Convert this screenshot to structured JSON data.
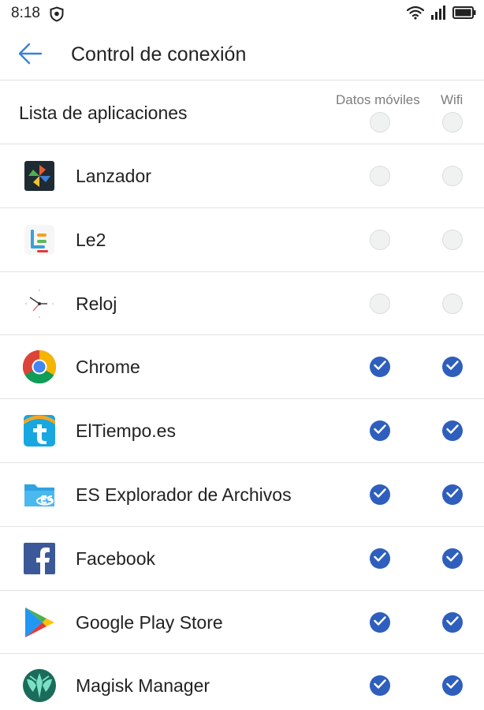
{
  "status_bar": {
    "time": "8:18",
    "left_icons": [
      "shield-icon"
    ],
    "right_icons": [
      "wifi-icon",
      "signal-icon",
      "battery-icon"
    ]
  },
  "app_bar": {
    "back_icon": "arrow-left-icon",
    "title": "Control de conexión"
  },
  "list_header": {
    "title": "Lista de aplicaciones",
    "col_mobile": "Datos móviles",
    "col_wifi": "Wifi",
    "mobile_checked": false,
    "wifi_checked": false
  },
  "apps": [
    {
      "name": "Lanzador",
      "icon": "lanzador-icon",
      "mobile": false,
      "wifi": false
    },
    {
      "name": "Le2",
      "icon": "le2-icon",
      "mobile": false,
      "wifi": false
    },
    {
      "name": "Reloj",
      "icon": "clock-icon",
      "mobile": false,
      "wifi": false
    },
    {
      "name": "Chrome",
      "icon": "chrome-icon",
      "mobile": true,
      "wifi": true
    },
    {
      "name": "ElTiempo.es",
      "icon": "eltiempo-icon",
      "mobile": true,
      "wifi": true
    },
    {
      "name": "ES Explorador de Archivos",
      "icon": "es-explorer-icon",
      "mobile": true,
      "wifi": true
    },
    {
      "name": "Facebook",
      "icon": "facebook-icon",
      "mobile": true,
      "wifi": true
    },
    {
      "name": "Google Play Store",
      "icon": "play-store-icon",
      "mobile": true,
      "wifi": true
    },
    {
      "name": "Magisk Manager",
      "icon": "magisk-icon",
      "mobile": true,
      "wifi": true
    }
  ],
  "colors": {
    "accent": "#2f5fbd",
    "back_arrow": "#3b82d6",
    "divider": "#e2e2e2",
    "unchecked_fill": "#f0f2f1"
  }
}
